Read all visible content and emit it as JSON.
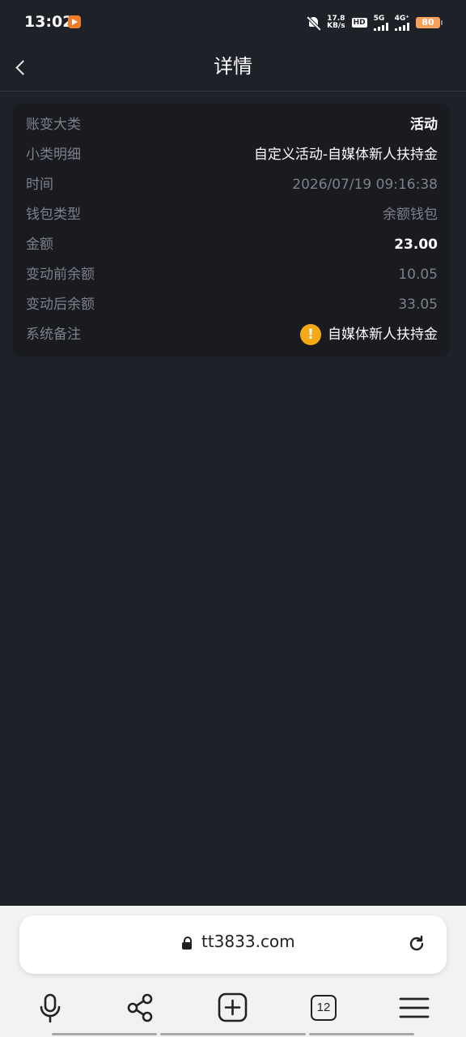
{
  "status_bar": {
    "time": "13:02",
    "net_speed_value": "17.8",
    "net_speed_unit": "KB/s",
    "hd_badge": "HD",
    "net_1": "5G",
    "net_2": "4G⁺",
    "battery": "80"
  },
  "header": {
    "title": "详情",
    "back_icon": "chevron-left-icon"
  },
  "detail": {
    "rows": [
      {
        "label": "账变大类",
        "value": "活动"
      },
      {
        "label": "小类明细",
        "value": "自定义活动-自媒体新人扶持金"
      },
      {
        "label": "时间",
        "value": "2026/07/19 09:16:38"
      },
      {
        "label": "钱包类型",
        "value": "余额钱包"
      },
      {
        "label": "金额",
        "value": "23.00"
      },
      {
        "label": "变动前余额",
        "value": "10.05"
      },
      {
        "label": "变动后余额",
        "value": "33.05"
      },
      {
        "label": "系统备注",
        "value": "自媒体新人扶持金",
        "icon": "!"
      }
    ]
  },
  "browser": {
    "url": "tt3833.com",
    "tab_count": "12",
    "icons": [
      "lock-icon",
      "reload-icon",
      "microphone-icon",
      "share-icon",
      "new-tab-icon",
      "tabs-icon",
      "menu-icon"
    ]
  },
  "colors": {
    "background": "#1f2129",
    "card": "#1a1b20",
    "label": "#7e8089",
    "warning": "#f6a817"
  }
}
